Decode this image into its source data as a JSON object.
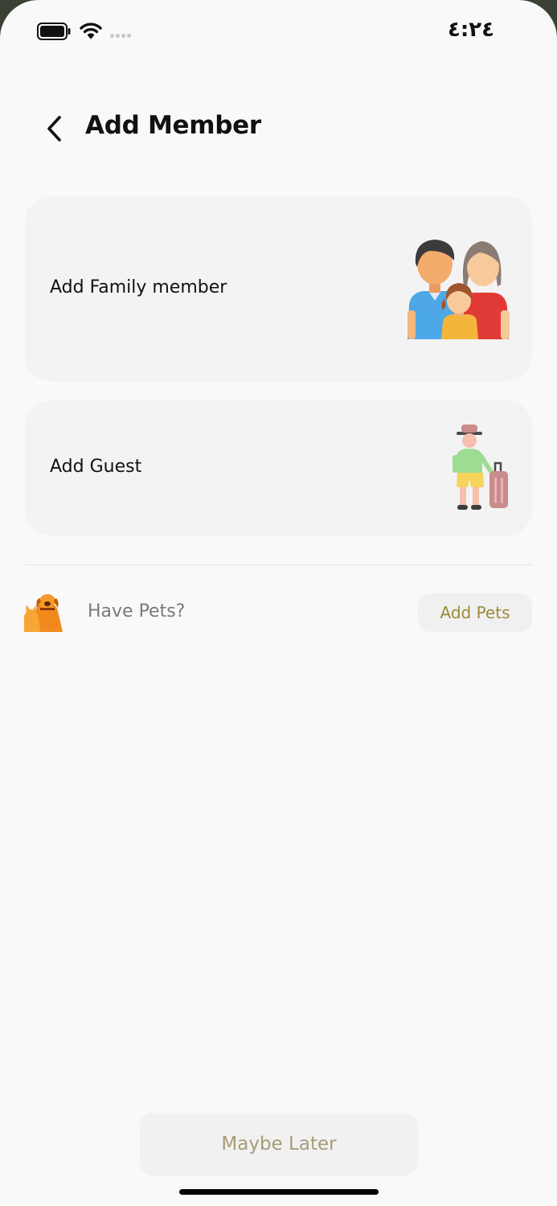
{
  "status_bar": {
    "time": "٤:٢٤",
    "battery_icon": "battery-full-icon",
    "wifi_icon": "wifi-icon",
    "signal_icon": "signal-dots-icon"
  },
  "header": {
    "back_icon": "chevron-left-icon",
    "title": "Add Member"
  },
  "options": [
    {
      "label": "Add Family member",
      "icon": "family-illustration"
    },
    {
      "label": "Add Guest",
      "icon": "traveler-with-suitcase-illustration"
    }
  ],
  "pets": {
    "icon": "pets-illustration",
    "question": "Have Pets?",
    "button_label": "Add Pets"
  },
  "footer": {
    "maybe_later_label": "Maybe Later"
  },
  "colors": {
    "accent_text": "#9c8a3a",
    "muted_accent": "#a79b76",
    "card_bg": "#f3f3f3",
    "page_bg": "#f9f9f9"
  }
}
